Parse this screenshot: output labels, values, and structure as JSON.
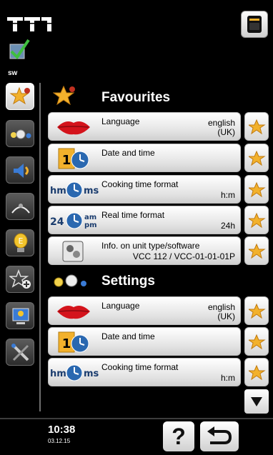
{
  "status": {
    "user_label": "sw",
    "time": "10:38",
    "date": "03.12.15"
  },
  "sidebar": {
    "items": [
      {
        "name": "favourites",
        "icon": "star-user-icon"
      },
      {
        "name": "cooking-settings",
        "icon": "cooking-gears-icon"
      },
      {
        "name": "sound",
        "icon": "speaker-icon"
      },
      {
        "name": "lighting",
        "icon": "light-icon"
      },
      {
        "name": "info",
        "icon": "lightbulb-e-icon"
      },
      {
        "name": "manage-favourites",
        "icon": "star-plus-icon"
      },
      {
        "name": "display",
        "icon": "monitor-user-icon"
      },
      {
        "name": "service",
        "icon": "tools-icon"
      }
    ]
  },
  "sections": {
    "favourites": {
      "title": "Favourites",
      "rows": [
        {
          "label": "Language",
          "value": "english (UK)",
          "icon": "lips-icon"
        },
        {
          "label": "Date and time",
          "value": "",
          "icon": "calendar-clock-icon"
        },
        {
          "label": "Cooking time format",
          "value": "h:m",
          "icon": "hm-ms-clock-icon"
        },
        {
          "label": "Real time format",
          "value": "24h",
          "icon": "24-ampm-clock-icon"
        },
        {
          "label": "Info. on unit type/software",
          "value": "VCC 112 / VCC-01-01-01P",
          "icon": "unit-info-icon"
        }
      ]
    },
    "settings": {
      "title": "Settings",
      "rows": [
        {
          "label": "Language",
          "value": "english (UK)",
          "icon": "lips-icon"
        },
        {
          "label": "Date and time",
          "value": "",
          "icon": "calendar-clock-icon"
        },
        {
          "label": "Cooking time format",
          "value": "h:m",
          "icon": "hm-ms-clock-icon"
        }
      ]
    }
  },
  "buttons": {
    "help_label": "?"
  },
  "colors": {
    "background": "#000000",
    "star": "#f2b12c",
    "lips": "#d4141c",
    "clock_blue": "#2a68b0"
  }
}
